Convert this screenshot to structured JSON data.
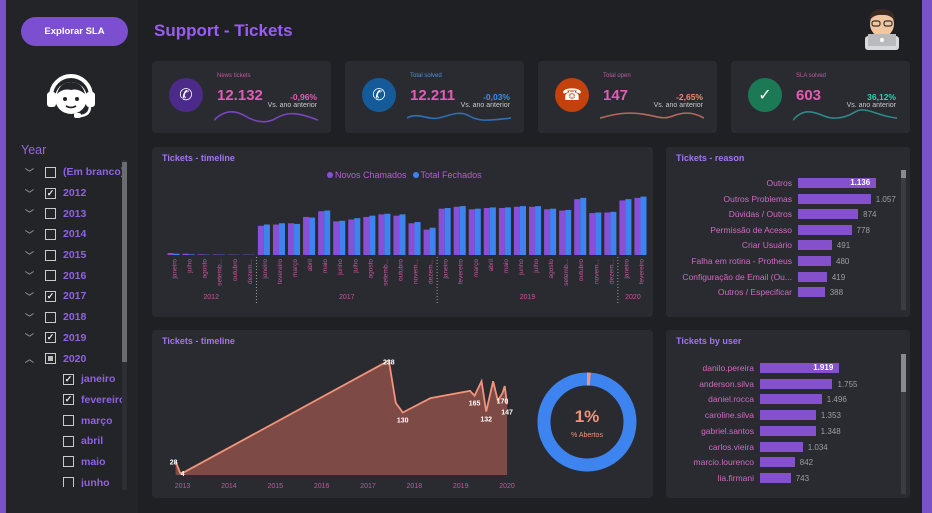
{
  "sidebar": {
    "explore_button": "Explorar SLA",
    "year_title": "Year",
    "years": [
      {
        "label": "(Em branco)",
        "checked": false,
        "chevron": "down"
      },
      {
        "label": "2012",
        "checked": true,
        "chevron": "down"
      },
      {
        "label": "2013",
        "checked": false,
        "chevron": "down"
      },
      {
        "label": "2014",
        "checked": false,
        "chevron": "down"
      },
      {
        "label": "2015",
        "checked": false,
        "chevron": "down"
      },
      {
        "label": "2016",
        "checked": false,
        "chevron": "down"
      },
      {
        "label": "2017",
        "checked": true,
        "chevron": "down"
      },
      {
        "label": "2018",
        "checked": false,
        "chevron": "down"
      },
      {
        "label": "2019",
        "checked": true,
        "chevron": "down"
      },
      {
        "label": "2020",
        "checked": "partial",
        "chevron": "up"
      }
    ],
    "months": [
      {
        "label": "janeiro",
        "checked": true
      },
      {
        "label": "fevereiro",
        "checked": true
      },
      {
        "label": "março",
        "checked": false
      },
      {
        "label": "abril",
        "checked": false
      },
      {
        "label": "maio",
        "checked": false
      },
      {
        "label": "junho",
        "checked": false
      }
    ]
  },
  "header": {
    "title": "Support - Tickets"
  },
  "kpis": [
    {
      "label": "News tickets",
      "value": "12.132",
      "pct": "-0,96%",
      "sub": "Vs. ano anterior",
      "icon": "incoming-call-icon",
      "circle_color": "#4b2a8a",
      "label_color": "#c0579c",
      "pct_color": "#e35cb7",
      "spark_color": "#7a45c2"
    },
    {
      "label": "Total solved",
      "value": "12.211",
      "pct": "-0,03%",
      "sub": "Vs. ano anterior",
      "icon": "call-check-icon",
      "circle_color": "#155a99",
      "label_color": "#4f8fe0",
      "pct_color": "#3d8cf0",
      "spark_color": "#2e6fb8"
    },
    {
      "label": "Total open",
      "value": "147",
      "pct": "-2,65%",
      "sub": "Vs. ano anterior",
      "icon": "phone-clock-icon",
      "circle_color": "#c2410c",
      "label_color": "#c0579c",
      "pct_color": "#f08a6c",
      "spark_color": "#b46a5a"
    },
    {
      "label": "SLA solved",
      "value": "603",
      "pct": "36,12%",
      "sub": "Vs. ano anterior",
      "icon": "clipboard-check-icon",
      "circle_color": "#1b7a55",
      "label_color": "#c0579c",
      "pct_color": "#2fd0b0",
      "spark_color": "#2f8a8a"
    }
  ],
  "timeline_bars": {
    "title": "Tickets - timeline",
    "legend": [
      "Novos Chamados",
      "Total Fechados"
    ],
    "colors": [
      "#8a4fd8",
      "#3e84f0"
    ],
    "chart_data": {
      "type": "bar",
      "categories": [
        "janeiro",
        "julho",
        "agosto",
        "setemb...",
        "outubro",
        "dezem...",
        "janeiro",
        "fevereiro",
        "março",
        "abril",
        "maio",
        "junho",
        "julho",
        "agosto",
        "setemb...",
        "outubro",
        "novem...",
        "dezem...",
        "janeiro",
        "fevereiro",
        "março",
        "abril",
        "maio",
        "junho",
        "julho",
        "agosto",
        "setemb...",
        "outubro",
        "novem...",
        "dezem...",
        "janeiro",
        "fevereiro"
      ],
      "groups": [
        {
          "label": "2012",
          "from": 0,
          "to": 5
        },
        {
          "label": "2017",
          "from": 6,
          "to": 17
        },
        {
          "label": "2019",
          "from": 18,
          "to": 29
        },
        {
          "label": "2020",
          "from": 30,
          "to": 31
        }
      ],
      "series": [
        {
          "name": "Novos Chamados",
          "values": [
            15,
            10,
            5,
            4,
            3,
            3,
            230,
            240,
            250,
            300,
            345,
            265,
            280,
            300,
            320,
            310,
            250,
            200,
            365,
            380,
            360,
            370,
            370,
            380,
            380,
            360,
            350,
            440,
            330,
            335,
            430,
            450
          ]
        },
        {
          "name": "Total Fechados",
          "values": [
            10,
            5,
            3,
            3,
            2,
            2,
            240,
            250,
            245,
            295,
            350,
            270,
            290,
            310,
            325,
            320,
            260,
            215,
            370,
            385,
            365,
            375,
            375,
            385,
            385,
            365,
            355,
            450,
            335,
            340,
            440,
            460
          ]
        }
      ],
      "ylim": [
        0,
        520
      ]
    }
  },
  "reason": {
    "title": "Tickets - reason",
    "chart_data": {
      "type": "bar",
      "categories": [
        "Outros",
        "Outros Problemas",
        "Dúvidas / Outros",
        "Permissão de Acesso",
        "Criar Usuário",
        "Falha em rotina - Protheus",
        "Configuração de Email (Ou...",
        "Outros / Especificar"
      ],
      "values": [
        1136,
        1057,
        874,
        778,
        491,
        480,
        419,
        388
      ],
      "labels": [
        "1.136",
        "1.057",
        "874",
        "778",
        "491",
        "480",
        "419",
        "388"
      ],
      "xlim": [
        0,
        1380
      ]
    }
  },
  "timeline_area": {
    "title": "Tickets - timeline",
    "chart_data": {
      "type": "area",
      "x_ticks": [
        "2013",
        "2014",
        "2015",
        "2016",
        "2017",
        "2018",
        "2019",
        "2020"
      ],
      "points": [
        [
          2012.85,
          28
        ],
        [
          2012.95,
          4
        ],
        [
          2013.0,
          4
        ],
        [
          2017.45,
          238
        ],
        [
          2017.6,
          150
        ],
        [
          2017.75,
          130
        ],
        [
          2018.35,
          160
        ],
        [
          2019.2,
          175
        ],
        [
          2019.3,
          165
        ],
        [
          2019.45,
          195
        ],
        [
          2019.55,
          132
        ],
        [
          2019.7,
          195
        ],
        [
          2019.8,
          155
        ],
        [
          2019.9,
          170
        ],
        [
          2019.95,
          185
        ],
        [
          2020.0,
          147
        ]
      ],
      "labels": [
        {
          "x": 2012.85,
          "y": 28,
          "text": "28"
        },
        {
          "x": 2013.0,
          "y": 4,
          "text": "4"
        },
        {
          "x": 2017.45,
          "y": 238,
          "text": "238"
        },
        {
          "x": 2017.75,
          "y": 130,
          "text": "130"
        },
        {
          "x": 2019.3,
          "y": 165,
          "text": "165"
        },
        {
          "x": 2019.55,
          "y": 132,
          "text": "132"
        },
        {
          "x": 2019.9,
          "y": 170,
          "text": "170"
        },
        {
          "x": 2020.0,
          "y": 147,
          "text": "147"
        }
      ],
      "xlim": [
        2012.6,
        2020.15
      ],
      "ylim": [
        0,
        260
      ]
    }
  },
  "donut": {
    "value": "1%",
    "label": "% Abertos",
    "percent": 1.2,
    "colors": [
      "#f2937a",
      "#3e84f0"
    ]
  },
  "users": {
    "title": "Tickets by user",
    "chart_data": {
      "type": "bar",
      "categories": [
        "danilo.pereira",
        "anderson.silva",
        "daniel.rocca",
        "caroline.silva",
        "gabriel.santos",
        "carlos.vieira",
        "marcio.lourenco",
        "lia.firmani"
      ],
      "values": [
        1919,
        1755,
        1496,
        1353,
        1348,
        1034,
        842,
        743
      ],
      "labels": [
        "1.919",
        "1.755",
        "1.496",
        "1.353",
        "1.348",
        "1.034",
        "842",
        "743"
      ],
      "xlim": [
        0,
        2300
      ]
    }
  }
}
